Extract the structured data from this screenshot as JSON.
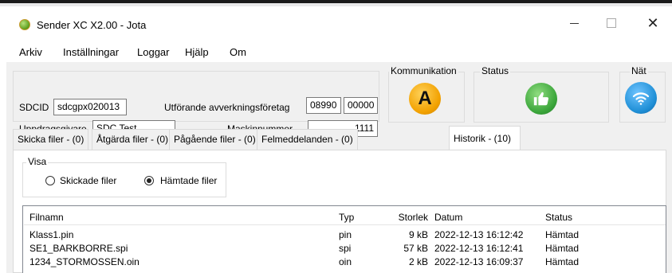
{
  "window": {
    "title": "Sender XC X2.00 - Jota"
  },
  "menu": [
    "Arkiv",
    "Inställningar",
    "Loggar",
    "Hjälp",
    "Om"
  ],
  "form": {
    "sdcid_label": "SDCID",
    "sdcid_value": "sdcgpx020013",
    "utforande_label": "Utförande avverkningsföretag",
    "utforande_value1": "08990",
    "utforande_value2": "00000",
    "uppdrag_label": "Uppdragsgivare",
    "uppdrag_value": "SDC Test",
    "maskin_label": "Maskinnummer",
    "maskin_value": "1111"
  },
  "indicators": {
    "kommunikation_label": "Kommunikation",
    "kommunikation_letter": "A",
    "status_label": "Status",
    "nat_label": "Nät",
    "colors": {
      "kommunikation": "#f2a100",
      "status": "#3aa53a",
      "nat": "#1f8fd6"
    }
  },
  "tabs": [
    {
      "label": "Skicka filer - (0)"
    },
    {
      "label": "Åtgärda filer - (0)"
    },
    {
      "label": "Pågående filer - (0)"
    },
    {
      "label": "Felmeddelanden - (0)"
    },
    {
      "label": "Historik - (10)"
    }
  ],
  "visa": {
    "label": "Visa",
    "options": [
      "Skickade filer",
      "Hämtade filer"
    ],
    "selected": "Hämtade filer"
  },
  "table": {
    "columns": [
      "Filnamn",
      "Typ",
      "Storlek",
      "Datum",
      "Status"
    ],
    "rows": [
      {
        "name": "Klass1.pin",
        "type": "pin",
        "size": "9 kB",
        "date": "2022-12-13 16:12:42",
        "status": "Hämtad"
      },
      {
        "name": "SE1_BARKBORRE.spi",
        "type": "spi",
        "size": "57 kB",
        "date": "2022-12-13 16:12:41",
        "status": "Hämtad"
      },
      {
        "name": "1234_STORMOSSEN.oin",
        "type": "oin",
        "size": "2 kB",
        "date": "2022-12-13 16:09:37",
        "status": "Hämtad"
      }
    ]
  }
}
